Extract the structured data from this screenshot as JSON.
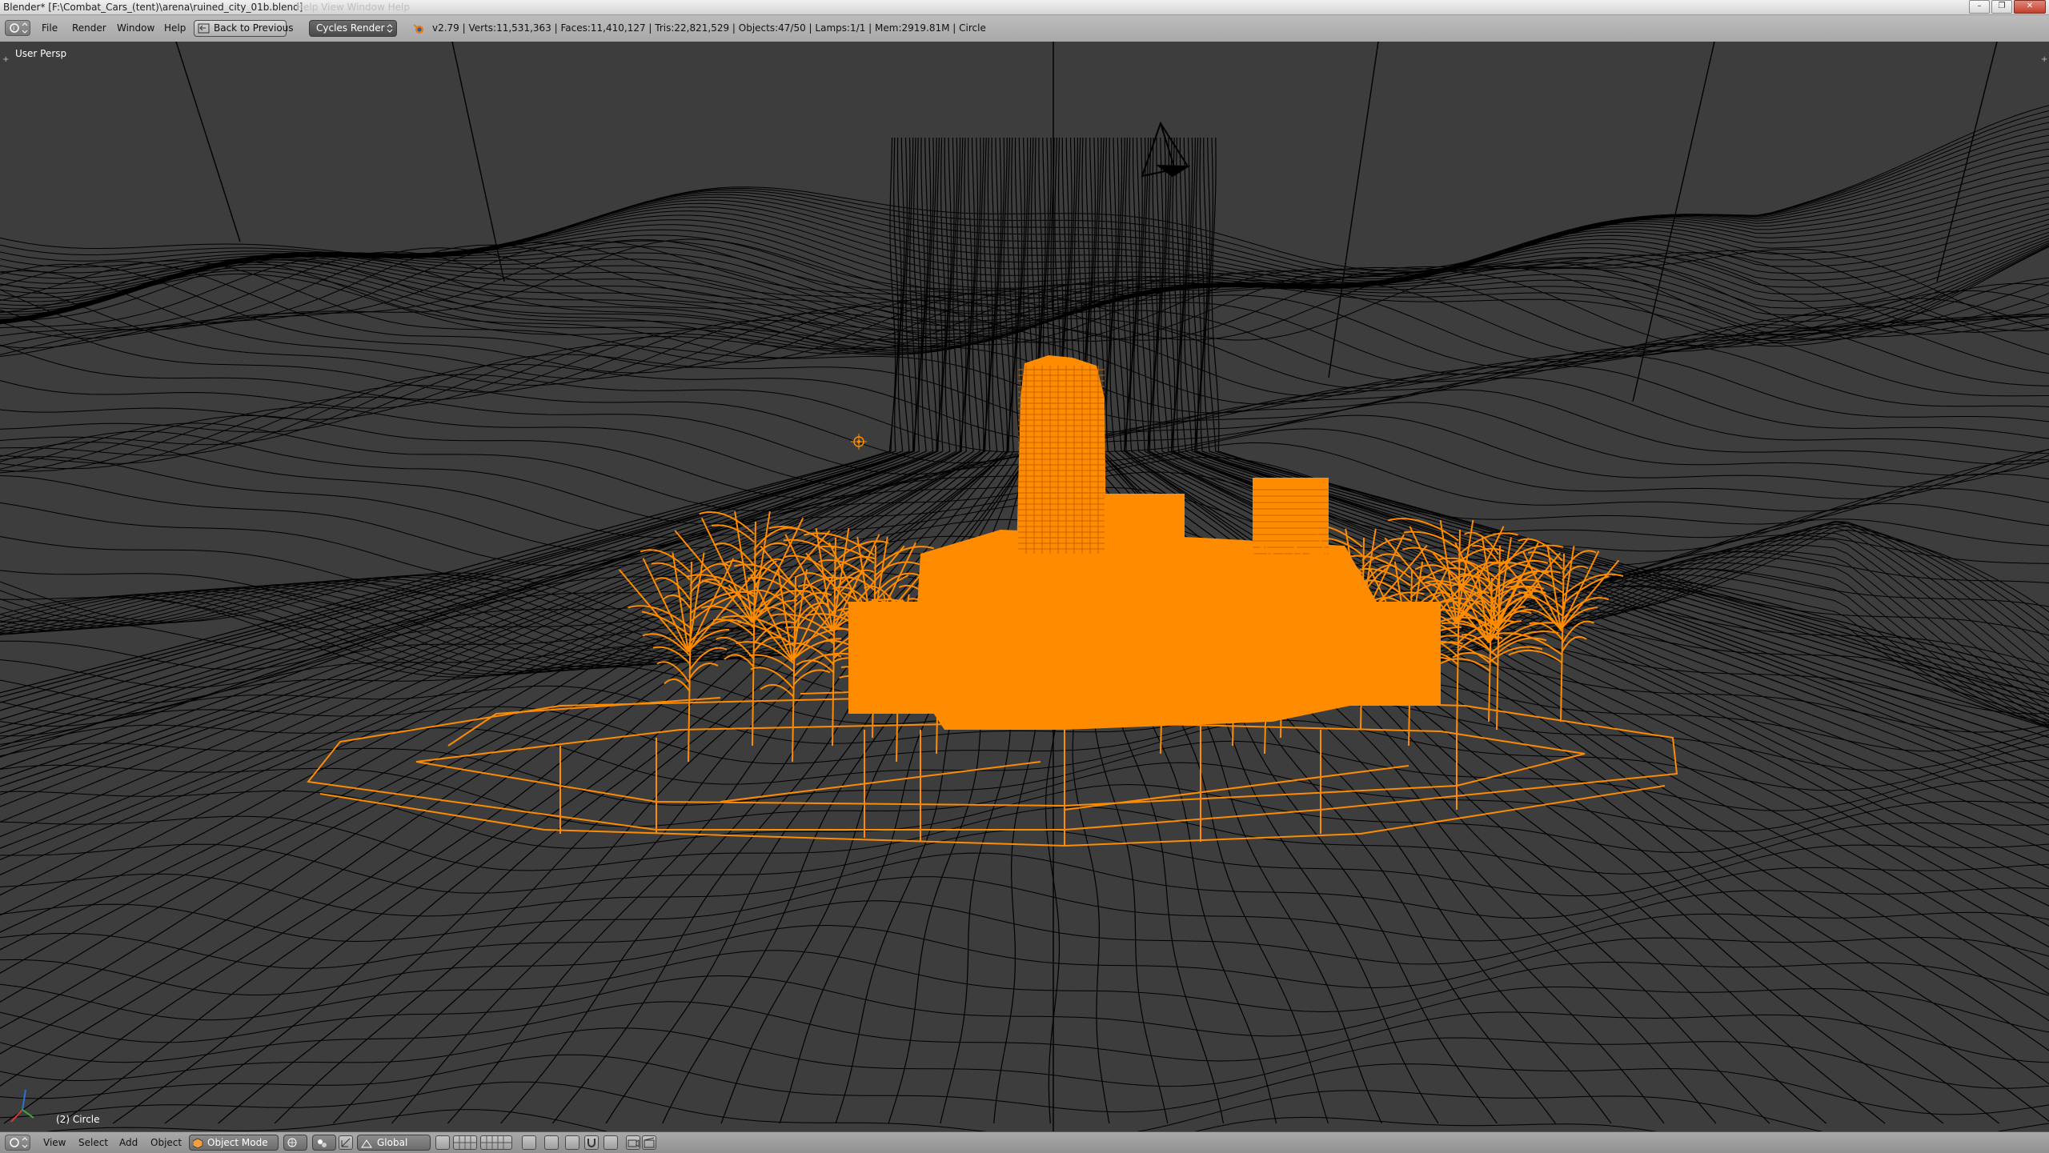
{
  "window": {
    "title": "Blender* [F:\\Combat_Cars_(tent)\\arena\\ruined_city_01b.blend]",
    "ghost_menus": "Help    View    Window    Help"
  },
  "info_header": {
    "menus": [
      "File",
      "Render",
      "Window",
      "Help"
    ],
    "back_button": "Back to Previous",
    "render_engine": "Cycles Render",
    "stats": "v2.79 | Verts:11,531,363 | Faces:11,410,127 | Tris:22,821,529 | Objects:47/50 | Lamps:1/1 | Mem:2919.81M | Circle"
  },
  "viewport": {
    "view_label": "User Persp",
    "active_object": "(2) Circle",
    "colors": {
      "background": "#3d3d3d",
      "wire": "#000000",
      "selected": "#ff8c00"
    }
  },
  "toolbar": {
    "menus": [
      "View",
      "Select",
      "Add",
      "Object"
    ],
    "mode": "Object Mode",
    "orientation": "Global"
  }
}
